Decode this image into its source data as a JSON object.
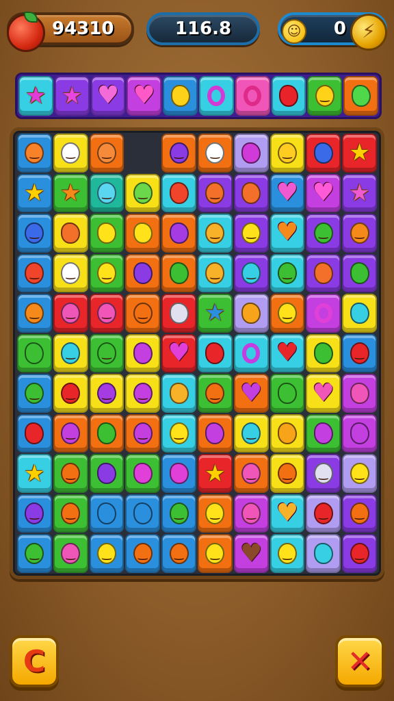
{
  "hud": {
    "score": "94310",
    "center_value": "116.8",
    "coins": "0",
    "smiley_glyph": "☺",
    "coin_glyph": "⚡"
  },
  "palette": {
    "R": "#e8262a",
    "O": "#f26f12",
    "Y": "#f7e018",
    "G": "#3cbf33",
    "C": "#36cfe3",
    "B": "#2a8fdd",
    "P": "#8a3be3",
    "M": "#c43fe0",
    "K": "#f055b8",
    "L": "#b09cf0",
    "T": "#1fb89a"
  },
  "top_strip": [
    {
      "bg": "C",
      "icon": "star",
      "color": "#e03cd8"
    },
    {
      "bg": "P",
      "icon": "star",
      "color": "#e846e0"
    },
    {
      "bg": "P",
      "icon": "heart",
      "color": "#f26bd8"
    },
    {
      "bg": "M",
      "icon": "heart",
      "color": "#ff59c8"
    },
    {
      "bg": "B",
      "icon": "blob",
      "color": "#ffd21a"
    },
    {
      "bg": "C",
      "icon": "ring",
      "color": "#d13bd4"
    },
    {
      "bg": "K",
      "icon": "ring",
      "color": "#e02a8a"
    },
    {
      "bg": "C",
      "icon": "blob",
      "color": "#e8232a"
    },
    {
      "bg": "G",
      "icon": "face",
      "color": "#ffd21a"
    },
    {
      "bg": "O",
      "icon": "blob",
      "color": "#4fd84a"
    }
  ],
  "board": [
    [
      {
        "bg": "B",
        "icon": "face",
        "color": "#f7822a"
      },
      {
        "bg": "Y",
        "icon": "face",
        "color": "#ffffff"
      },
      {
        "bg": "O",
        "icon": "face",
        "color": "#f58a3a"
      },
      {
        "bg": "empty"
      },
      {
        "bg": "O",
        "icon": "face",
        "color": "#8a3be3"
      },
      {
        "bg": "O",
        "icon": "face",
        "color": "#ffffff"
      },
      {
        "bg": "L",
        "icon": "blob",
        "color": "#d03ad8"
      },
      {
        "bg": "Y",
        "icon": "face",
        "color": "#ffcc22"
      },
      {
        "bg": "R",
        "icon": "blob",
        "color": "#3a6ae8"
      },
      {
        "bg": "R",
        "icon": "star",
        "color": "#ffd000"
      }
    ],
    [
      {
        "bg": "B",
        "icon": "star",
        "color": "#ffd000"
      },
      {
        "bg": "G",
        "icon": "star",
        "color": "#f58a1a"
      },
      {
        "bg": "T",
        "icon": "face",
        "color": "#5ad6f0"
      },
      {
        "bg": "Y",
        "icon": "face",
        "color": "#6ad84a"
      },
      {
        "bg": "C",
        "icon": "blob",
        "color": "#f0452a"
      },
      {
        "bg": "P",
        "icon": "face",
        "color": "#f2702a"
      },
      {
        "bg": "P",
        "icon": "blob",
        "color": "#f2702a"
      },
      {
        "bg": "B",
        "icon": "heart",
        "color": "#f05ad0"
      },
      {
        "bg": "M",
        "icon": "heart",
        "color": "#ff5ad8"
      },
      {
        "bg": "P",
        "icon": "star",
        "color": "#f05ad0"
      }
    ],
    [
      {
        "bg": "B",
        "icon": "face",
        "color": "#3a6ae8"
      },
      {
        "bg": "Y",
        "icon": "blob",
        "color": "#f2702a"
      },
      {
        "bg": "G",
        "icon": "blob",
        "color": "#ffe21a"
      },
      {
        "bg": "O",
        "icon": "blob",
        "color": "#ffe21a"
      },
      {
        "bg": "O",
        "icon": "blob",
        "color": "#a43be3"
      },
      {
        "bg": "C",
        "icon": "face",
        "color": "#f7b22a"
      },
      {
        "bg": "P",
        "icon": "face",
        "color": "#ffe21a"
      },
      {
        "bg": "C",
        "icon": "heart",
        "color": "#f58a1a"
      },
      {
        "bg": "P",
        "icon": "face",
        "color": "#3cbf33"
      },
      {
        "bg": "P",
        "icon": "face",
        "color": "#f58a1a"
      }
    ],
    [
      {
        "bg": "B",
        "icon": "face",
        "color": "#f0452a"
      },
      {
        "bg": "Y",
        "icon": "face",
        "color": "#ffffff"
      },
      {
        "bg": "G",
        "icon": "face",
        "color": "#ffe21a"
      },
      {
        "bg": "O",
        "icon": "blob",
        "color": "#8a3be3"
      },
      {
        "bg": "O",
        "icon": "blob",
        "color": "#3cbf33"
      },
      {
        "bg": "C",
        "icon": "face",
        "color": "#f7b22a"
      },
      {
        "bg": "P",
        "icon": "face",
        "color": "#36cfe3"
      },
      {
        "bg": "C",
        "icon": "face",
        "color": "#3cbf33"
      },
      {
        "bg": "P",
        "icon": "blob",
        "color": "#f2702a"
      },
      {
        "bg": "P",
        "icon": "blob",
        "color": "#3cbf33"
      }
    ],
    [
      {
        "bg": "B",
        "icon": "face",
        "color": "#f58a1a"
      },
      {
        "bg": "R",
        "icon": "face",
        "color": "#f055b8"
      },
      {
        "bg": "R",
        "icon": "face",
        "color": "#f055b8"
      },
      {
        "bg": "O",
        "icon": "face",
        "color": "#f26f12"
      },
      {
        "bg": "R",
        "icon": "blob",
        "color": "#e0e0f0"
      },
      {
        "bg": "G",
        "icon": "star",
        "color": "#2a8fdd"
      },
      {
        "bg": "L",
        "icon": "blob",
        "color": "#f7a41a"
      },
      {
        "bg": "O",
        "icon": "face",
        "color": "#ffe21a"
      },
      {
        "bg": "M",
        "icon": "ring",
        "color": "#e040d8"
      },
      {
        "bg": "Y",
        "icon": "blob",
        "color": "#36cfe3"
      }
    ],
    [
      {
        "bg": "G",
        "icon": "blob",
        "color": "#3cbf33"
      },
      {
        "bg": "Y",
        "icon": "face",
        "color": "#36cfe3"
      },
      {
        "bg": "G",
        "icon": "face",
        "color": "#3cbf33"
      },
      {
        "bg": "Y",
        "icon": "blob",
        "color": "#c43fe0"
      },
      {
        "bg": "R",
        "icon": "heart",
        "color": "#e040d8"
      },
      {
        "bg": "C",
        "icon": "blob",
        "color": "#e8262a"
      },
      {
        "bg": "C",
        "icon": "ring",
        "color": "#c43fe0"
      },
      {
        "bg": "C",
        "icon": "heart",
        "color": "#e8262a"
      },
      {
        "bg": "Y",
        "icon": "blob",
        "color": "#3cbf33"
      },
      {
        "bg": "B",
        "icon": "face",
        "color": "#e8262a"
      }
    ],
    [
      {
        "bg": "B",
        "icon": "face",
        "color": "#3cbf33"
      },
      {
        "bg": "Y",
        "icon": "face",
        "color": "#e8262a"
      },
      {
        "bg": "Y",
        "icon": "face",
        "color": "#a43be3"
      },
      {
        "bg": "Y",
        "icon": "face",
        "color": "#c43fe0"
      },
      {
        "bg": "C",
        "icon": "blob",
        "color": "#f7b22a"
      },
      {
        "bg": "G",
        "icon": "face",
        "color": "#f26f12"
      },
      {
        "bg": "O",
        "icon": "heart",
        "color": "#c43fe0"
      },
      {
        "bg": "G",
        "icon": "blob",
        "color": "#3cbf33"
      },
      {
        "bg": "Y",
        "icon": "heart",
        "color": "#f055b8"
      },
      {
        "bg": "M",
        "icon": "blob",
        "color": "#f055b8"
      }
    ],
    [
      {
        "bg": "B",
        "icon": "blob",
        "color": "#e8262a"
      },
      {
        "bg": "O",
        "icon": "face",
        "color": "#c43fe0"
      },
      {
        "bg": "O",
        "icon": "blob",
        "color": "#3cbf33"
      },
      {
        "bg": "O",
        "icon": "face",
        "color": "#c43fe0"
      },
      {
        "bg": "C",
        "icon": "face",
        "color": "#ffe21a"
      },
      {
        "bg": "O",
        "icon": "blob",
        "color": "#c43fe0"
      },
      {
        "bg": "Y",
        "icon": "face",
        "color": "#36cfe3"
      },
      {
        "bg": "Y",
        "icon": "blob",
        "color": "#f7a41a"
      },
      {
        "bg": "G",
        "icon": "blob",
        "color": "#c43fe0"
      },
      {
        "bg": "M",
        "icon": "blob",
        "color": "#c43fe0"
      }
    ],
    [
      {
        "bg": "C",
        "icon": "star",
        "color": "#ffd000"
      },
      {
        "bg": "G",
        "icon": "face",
        "color": "#f26f12"
      },
      {
        "bg": "G",
        "icon": "blob",
        "color": "#8a3be3"
      },
      {
        "bg": "G",
        "icon": "blob",
        "color": "#e040d8"
      },
      {
        "bg": "B",
        "icon": "blob",
        "color": "#e040d8"
      },
      {
        "bg": "R",
        "icon": "star",
        "color": "#ffd000"
      },
      {
        "bg": "O",
        "icon": "face",
        "color": "#f055b8"
      },
      {
        "bg": "Y",
        "icon": "face",
        "color": "#f26f12"
      },
      {
        "bg": "P",
        "icon": "face",
        "color": "#e0e0f0"
      },
      {
        "bg": "L",
        "icon": "face",
        "color": "#ffe21a"
      }
    ],
    [
      {
        "bg": "B",
        "icon": "face",
        "color": "#8a3be3"
      },
      {
        "bg": "G",
        "icon": "face",
        "color": "#f26f12"
      },
      {
        "bg": "B",
        "icon": "blob",
        "color": "#2a8fdd"
      },
      {
        "bg": "B",
        "icon": "blob",
        "color": "#2a8fdd"
      },
      {
        "bg": "B",
        "icon": "face",
        "color": "#3cbf33"
      },
      {
        "bg": "O",
        "icon": "face",
        "color": "#ffe21a"
      },
      {
        "bg": "M",
        "icon": "face",
        "color": "#f055b8"
      },
      {
        "bg": "C",
        "icon": "heart",
        "color": "#f7b22a"
      },
      {
        "bg": "L",
        "icon": "face",
        "color": "#e8262a"
      },
      {
        "bg": "P",
        "icon": "face",
        "color": "#f26f12"
      }
    ],
    [
      {
        "bg": "B",
        "icon": "face",
        "color": "#3cbf33"
      },
      {
        "bg": "G",
        "icon": "face",
        "color": "#f055b8"
      },
      {
        "bg": "B",
        "icon": "face",
        "color": "#ffe21a"
      },
      {
        "bg": "B",
        "icon": "face",
        "color": "#f26f12"
      },
      {
        "bg": "B",
        "icon": "face",
        "color": "#f26f12"
      },
      {
        "bg": "O",
        "icon": "face",
        "color": "#ffe21a"
      },
      {
        "bg": "M",
        "icon": "heart",
        "color": "#8a4a2a"
      },
      {
        "bg": "C",
        "icon": "face",
        "color": "#ffe21a"
      },
      {
        "bg": "L",
        "icon": "blob",
        "color": "#36cfe3"
      },
      {
        "bg": "P",
        "icon": "face",
        "color": "#e8262a"
      }
    ]
  ],
  "buttons": {
    "undo_glyph": "C",
    "close_glyph": "✕"
  }
}
